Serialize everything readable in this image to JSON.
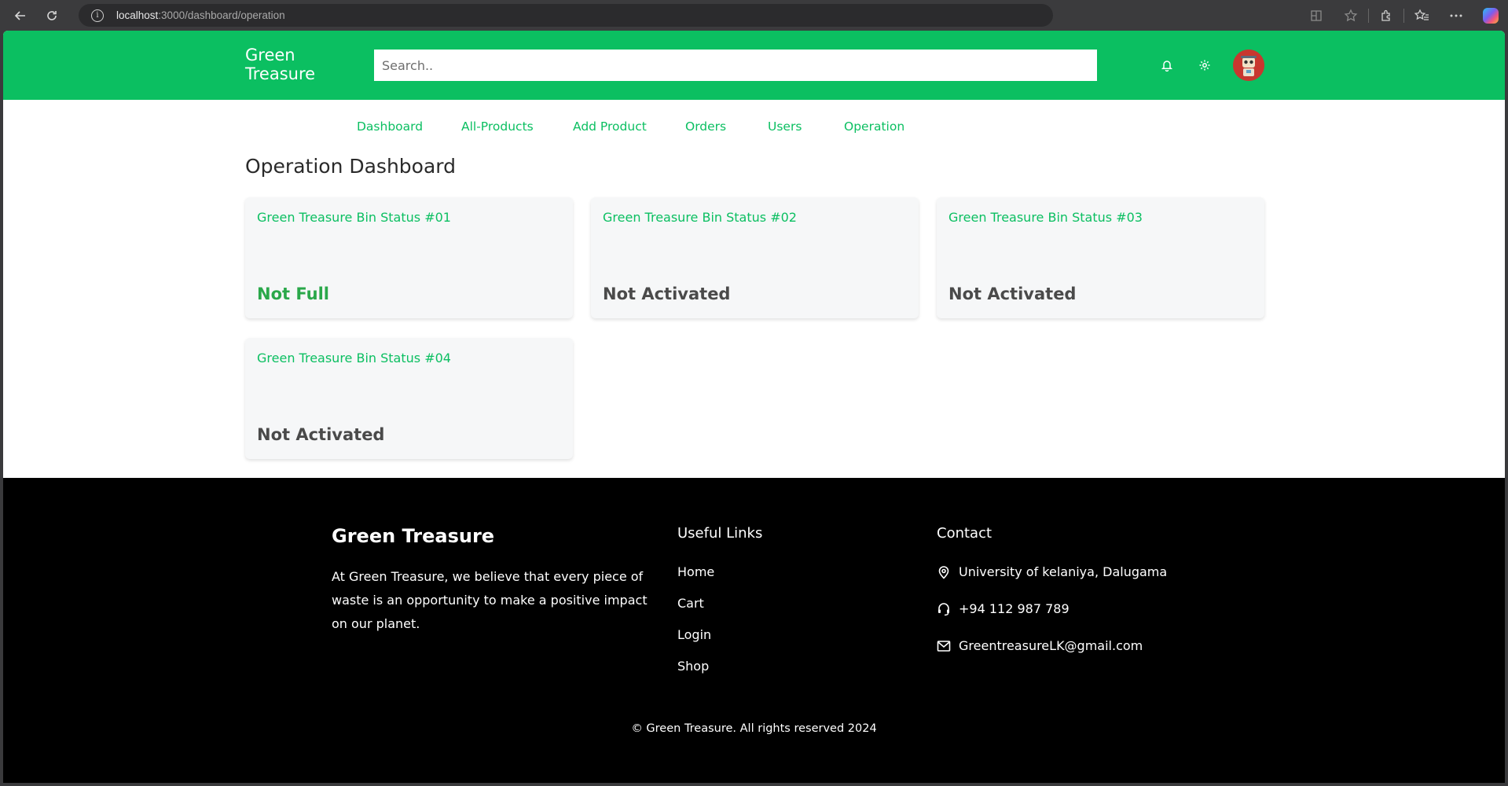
{
  "browser": {
    "url_host": "localhost",
    "url_rest": ":3000/dashboard/operation"
  },
  "header": {
    "brand": "Green Treasure",
    "search_placeholder": "Search.."
  },
  "nav": {
    "items": [
      {
        "label": "Dashboard"
      },
      {
        "label": "All-Products"
      },
      {
        "label": "Add Product"
      },
      {
        "label": "Orders"
      },
      {
        "label": "Users"
      },
      {
        "label": "Operation"
      }
    ]
  },
  "main": {
    "title": "Operation Dashboard",
    "bins": [
      {
        "title": "Green Treasure Bin Status #01",
        "status": "Not Full",
        "status_color": "#2aa84a"
      },
      {
        "title": "Green Treasure Bin Status #02",
        "status": "Not Activated",
        "status_color": "#4a4a4a"
      },
      {
        "title": "Green Treasure Bin Status #03",
        "status": "Not Activated",
        "status_color": "#4a4a4a"
      },
      {
        "title": "Green Treasure Bin Status #04",
        "status": "Not Activated",
        "status_color": "#4a4a4a"
      }
    ]
  },
  "footer": {
    "brand": "Green Treasure",
    "description": "At Green Treasure, we believe that every piece of waste is an opportunity to make a positive impact on our planet.",
    "links_heading": "Useful Links",
    "links": [
      {
        "label": "Home"
      },
      {
        "label": "Cart"
      },
      {
        "label": "Login"
      },
      {
        "label": "Shop"
      }
    ],
    "contact_heading": "Contact",
    "contact": {
      "address": "University of kelaniya, Dalugama",
      "phone": "+94 112 987 789",
      "email": "GreentreasureLK@gmail.com"
    },
    "copyright": "© Green Treasure. All rights reserved 2024"
  },
  "colors": {
    "brand_green": "#0bbf61",
    "footer_bg": "#000000"
  }
}
